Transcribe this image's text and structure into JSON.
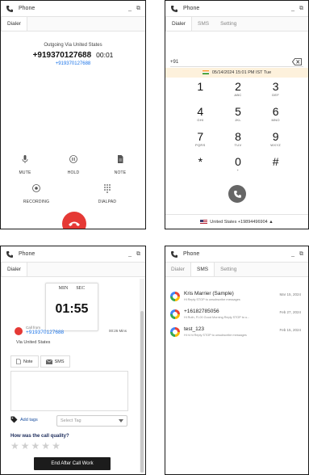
{
  "app": {
    "title": "Phone"
  },
  "panel1": {
    "tab": "Dialer",
    "outgoing_label": "Outgoing Via United States",
    "number": "+919370127688",
    "timer": "00:01",
    "sub_number": "+919370127688",
    "controls": [
      {
        "label": "MUTE",
        "icon": "mic-icon"
      },
      {
        "label": "HOLD",
        "icon": "pause-icon"
      },
      {
        "label": "NOTE",
        "icon": "note-icon"
      },
      {
        "label": "RECORDING",
        "icon": "record-icon"
      },
      {
        "label": "DIALPAD",
        "icon": "dialpad-icon"
      }
    ]
  },
  "panel2": {
    "tabs": [
      "Dialer",
      "SMS",
      "Setting"
    ],
    "input_value": "+91",
    "date_banner": "05/14/2024 15:01 PM IST Tue",
    "keys": [
      {
        "digit": "1",
        "letters": ""
      },
      {
        "digit": "2",
        "letters": "ABC"
      },
      {
        "digit": "3",
        "letters": "DEF"
      },
      {
        "digit": "4",
        "letters": "GHI"
      },
      {
        "digit": "5",
        "letters": "JKL"
      },
      {
        "digit": "6",
        "letters": "MNO"
      },
      {
        "digit": "7",
        "letters": "PQRS"
      },
      {
        "digit": "8",
        "letters": "TUV"
      },
      {
        "digit": "9",
        "letters": "WXYZ"
      },
      {
        "digit": "*",
        "letters": ""
      },
      {
        "digit": "0",
        "letters": "+"
      },
      {
        "digit": "#",
        "letters": ""
      }
    ],
    "footer": "United States +19894496904"
  },
  "panel3": {
    "tab": "Dialer",
    "min_label": "MIN",
    "sec_label": "SEC",
    "time": "01:55",
    "last_call_label": "Call from",
    "number": "+919370127688",
    "duration": "00:26 Mins",
    "via": "Via United States",
    "note_tab": "Note",
    "sms_tab": "SMS",
    "add_tags": "Add tags",
    "select_tag_placeholder": "Select Tag",
    "quality_label": "How was the call quality?",
    "end_button": "End After Call Work"
  },
  "panel4": {
    "tabs": [
      "Dialer",
      "SMS",
      "Setting"
    ],
    "messages": [
      {
        "name": "Kris Marrier (Sample)",
        "preview": "Hi Reply STOP to unsubscribe messages",
        "date": "Mar 15, 2024"
      },
      {
        "name": "+16182785056",
        "preview": "Hi Ruth, FI-00 Good Morning Reply STOP to u...",
        "date": "Feb 27, 2024"
      },
      {
        "name": "test_123",
        "preview": "Hi hi hi Reply STOP to unsubscribe messages",
        "date": "Feb 15, 2024"
      }
    ]
  },
  "colors": {
    "hangup": "#e53935",
    "call": "#666666",
    "link": "#1a73e8",
    "accent_dark": "#1c1c1c",
    "banner": "#fdf1dc"
  }
}
